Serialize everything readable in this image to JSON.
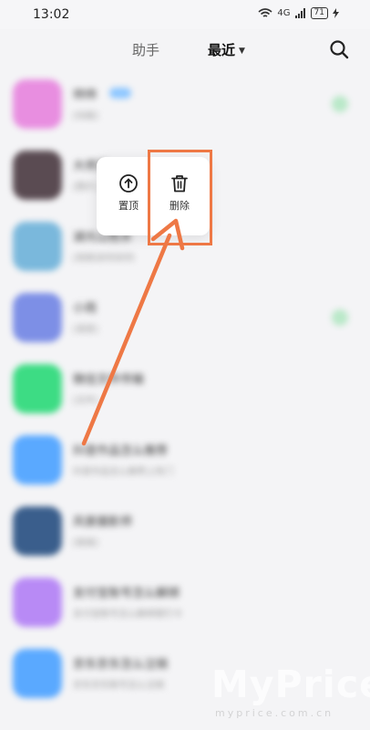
{
  "status_bar": {
    "time": "13:02",
    "network": "4G",
    "battery": "71"
  },
  "nav": {
    "tab_assistant": "助手",
    "tab_recent": "最近",
    "dropdown_icon": "triangle-down-icon",
    "search_icon": "search-icon"
  },
  "chats": [
    {
      "name": "帅帅",
      "preview": "[动画]",
      "avatar_color": "#e88ee0",
      "badge": true,
      "status": true
    },
    {
      "name": "大师兄",
      "preview": "[图片]",
      "avatar_color": "#5a4b52",
      "badge": false,
      "status": false
    },
    {
      "name": "湖光山色水",
      "preview": "[视频]好的好的",
      "avatar_color": "#7ab8dc",
      "badge": false,
      "status": false
    },
    {
      "name": "小雨",
      "preview": "[语音]",
      "avatar_color": "#7d8fe6",
      "badge": false,
      "status": true
    },
    {
      "name": "微信文件传输",
      "preview": "[文件]",
      "avatar_color": "#3ddc84",
      "badge": false,
      "status": false
    },
    {
      "name": "抖音作品怎么推荐",
      "preview": "抖音作品怎么推荐上热门",
      "avatar_color": "#5aa9ff",
      "badge": false,
      "status": false
    },
    {
      "name": "风景摄影师",
      "preview": "[链接]",
      "avatar_color": "#3a5e8c",
      "badge": false,
      "status": false
    },
    {
      "name": "支付宝账号怎么解绑",
      "preview": "支付宝账号怎么解绑银行卡",
      "avatar_color": "#b88af5",
      "badge": false,
      "status": false
    },
    {
      "name": "京东京东怎么注销",
      "preview": "京东京东账号怎么注销",
      "avatar_color": "#5aa9ff",
      "badge": false,
      "status": false
    }
  ],
  "context_menu": {
    "pin_label": "置顶",
    "delete_label": "删除"
  },
  "annotation": {
    "color": "#ee7845"
  },
  "watermark": {
    "text": "MyPrice",
    "sub": "myprice.com.cn"
  }
}
